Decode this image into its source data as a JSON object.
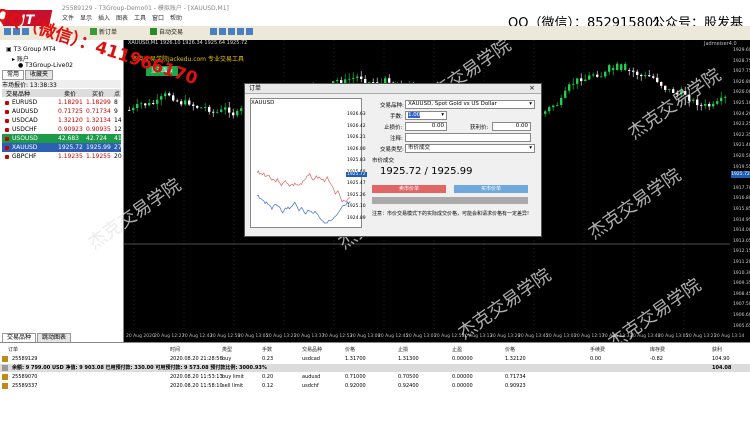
{
  "app": {
    "logo_text": "JT",
    "title": "25589129 - T3Group-Demo01 - 模拟账户 - [XAUUSD,M1]",
    "qq_contact": "QQ（微信）：852915801",
    "wechat_public": "公众号：股发基地"
  },
  "menu": [
    "文件",
    "显示",
    "插入",
    "图表",
    "工具",
    "窗口",
    "帮助"
  ],
  "toolbar": {
    "new_order": "新订单",
    "auto_trade": "自动交易"
  },
  "navigator": {
    "root": "T3 Group MT4",
    "accounts": "账户",
    "server": "T3Group-Live02",
    "tab_common": "常用",
    "tab_favorites": "收藏夹"
  },
  "market_watch": {
    "header": "市场报价: 13:38:33",
    "columns": [
      "交易品种",
      "卖价",
      "买价",
      "点"
    ],
    "rows": [
      {
        "symbol": "EURUSD",
        "bid": "1.18291",
        "ask": "1.18299",
        "spread": "8"
      },
      {
        "symbol": "AUDUSD",
        "bid": "0.71725",
        "ask": "0.71734",
        "spread": "9"
      },
      {
        "symbol": "USDCAD",
        "bid": "1.32120",
        "ask": "1.32134",
        "spread": "14"
      },
      {
        "symbol": "USDCHF",
        "bid": "0.90923",
        "ask": "0.90935",
        "spread": "12"
      },
      {
        "symbol": "USOUSD",
        "bid": "42.683",
        "ask": "42.724",
        "spread": "41"
      },
      {
        "symbol": "XAUUSD",
        "bid": "1925.72",
        "ask": "1925.99",
        "spread": "27"
      },
      {
        "symbol": "GBPCHF",
        "bid": "1.19235",
        "ask": "1.19255",
        "spread": "20"
      }
    ],
    "tab_symbols": "交易品种",
    "tab_ticks": "跳动图表"
  },
  "chart": {
    "title": "XAUUSD,M1  1926.10 1926.34 1925.64 1925.72",
    "right_tag": "Jadmeiser4.0",
    "signal_text": "杰克交易学院Jackedu.com 专业交易工具",
    "signal_button": "显示面板",
    "price_mark": "1925.72",
    "y_ticks": [
      "1929.60",
      "1928.75",
      "1927.75",
      "1926.80",
      "1926.00",
      "1925.10",
      "1924.20",
      "1923.25",
      "1922.35",
      "1921.40",
      "1920.50",
      "1919.55",
      "1918.65",
      "1917.70",
      "1916.80",
      "1915.85",
      "1914.95",
      "1914.00",
      "1913.05",
      "1912.15",
      "1911.20",
      "1910.30",
      "1909.35",
      "1908.45",
      "1907.50",
      "1906.60",
      "1905.65"
    ],
    "x_ticks": [
      "20 Aug 2020",
      "20 Aug 12:27",
      "20 Aug 12:43",
      "20 Aug 12:59",
      "20 Aug 13:05",
      "20 Aug 13:21",
      "20 Aug 13:37",
      "20 Aug 12:53",
      "20 Aug 13:09",
      "20 Aug 12:45",
      "20 Aug 13:01",
      "20 Aug 12:57",
      "20 Aug 13:13",
      "20 Aug 13:29",
      "20 Aug 13:45",
      "20 Aug 13:01",
      "20 Aug 12:17",
      "20 Aug 13:33",
      "20 Aug 13:49",
      "20 Aug 13:05",
      "20 Aug 13:21",
      "20 Aug 13:14"
    ]
  },
  "dialog": {
    "title": "订单",
    "mini_symbol": "XAUUSD",
    "mini_ticks": [
      "1926.63",
      "1926.42",
      "1926.21",
      "1926.00",
      "1925.83",
      "1925.68",
      "1925.47",
      "1925.26",
      "1925.10",
      "1924.89"
    ],
    "mini_price": "1925.72",
    "symbol_label": "交易品种:",
    "symbol_value": "XAUUSD, Spot Gold vs US Dollar",
    "volume_label": "手数:",
    "volume_value": "1.00",
    "stoploss_label": "止损价:",
    "stoploss_value": "0.00",
    "takeprofit_label": "获利价:",
    "takeprofit_value": "0.00",
    "comment_label": "注释:",
    "type_label": "交易类型:",
    "type_value": "市价成交",
    "section_label": "市价成交",
    "bid_ask": "1925.72 / 1925.99",
    "sell_button": "卖市价单",
    "buy_button": "买市价单",
    "note": "注意：市价交易模式下的实际成交价格，可能会和请求价格有一定差异!"
  },
  "terminal": {
    "columns": [
      "订单",
      "时间",
      "类型",
      "手数",
      "交易品种",
      "价格",
      "止损",
      "止盈",
      "价格",
      "手续费",
      "库存费",
      "获利"
    ],
    "rows": [
      {
        "order": "25589129",
        "time": "2020.08.20 21:28:56",
        "type": "buy",
        "lots": "0.23",
        "symbol": "usdcad",
        "price": "1.31700",
        "sl": "1.31300",
        "tp": "0.00000",
        "cur": "1.32120",
        "commission": "0.00",
        "swap": "-0.82",
        "profit": "104.90"
      },
      {
        "order": "余额: 9 799.00 USD  净值: 9 903.08  已用预付款: 330.00  可用预付款: 9 573.08  预付款比例: 3000.93%",
        "profit": "104.08",
        "balance": true
      },
      {
        "order": "25589070",
        "time": "2020.08.20 11:53:13",
        "type": "buy limit",
        "lots": "0.20",
        "symbol": "audusd",
        "price": "0.71000",
        "sl": "0.70500",
        "tp": "0.00000",
        "cur": "0.71734"
      },
      {
        "order": "25589337",
        "time": "2020.08.20 11:58:10",
        "type": "sell limit",
        "lots": "0.12",
        "symbol": "usdchf",
        "price": "0.92000",
        "sl": "0.92400",
        "tp": "0.00000",
        "cur": "0.90923"
      }
    ]
  },
  "watermarks": {
    "school": "杰克交易学院",
    "qq": "QQ（微信）：411966170"
  }
}
